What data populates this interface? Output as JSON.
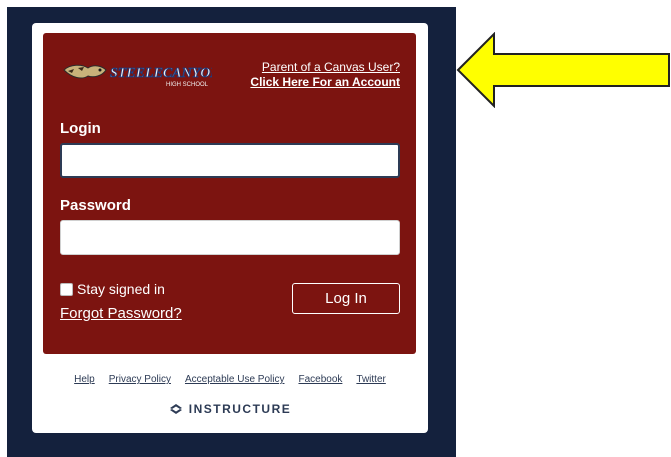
{
  "brand": {
    "logo_text": "STEELECANYON",
    "logo_sub": "HIGH SCHOOL"
  },
  "parent_link": {
    "line1": "Parent of a Canvas User?",
    "line2": "Click Here For an Account"
  },
  "login": {
    "label": "Login",
    "value": ""
  },
  "password": {
    "label": "Password",
    "value": ""
  },
  "stay_signed_in": "Stay signed in",
  "forgot_password": "Forgot Password?",
  "login_button": "Log In",
  "footer": {
    "links": [
      "Help",
      "Privacy Policy",
      "Acceptable Use Policy",
      "Facebook",
      "Twitter"
    ],
    "powered_by": "INSTRUCTURE"
  },
  "colors": {
    "navy": "#14213d",
    "panel_red": "#7c1410",
    "arrow_yellow": "#ffff00"
  },
  "icons": {
    "arrow": "left-pointing-yellow-arrow",
    "instructure": "instructure-logo-icon",
    "mascot": "cougar-mascot-icon"
  }
}
